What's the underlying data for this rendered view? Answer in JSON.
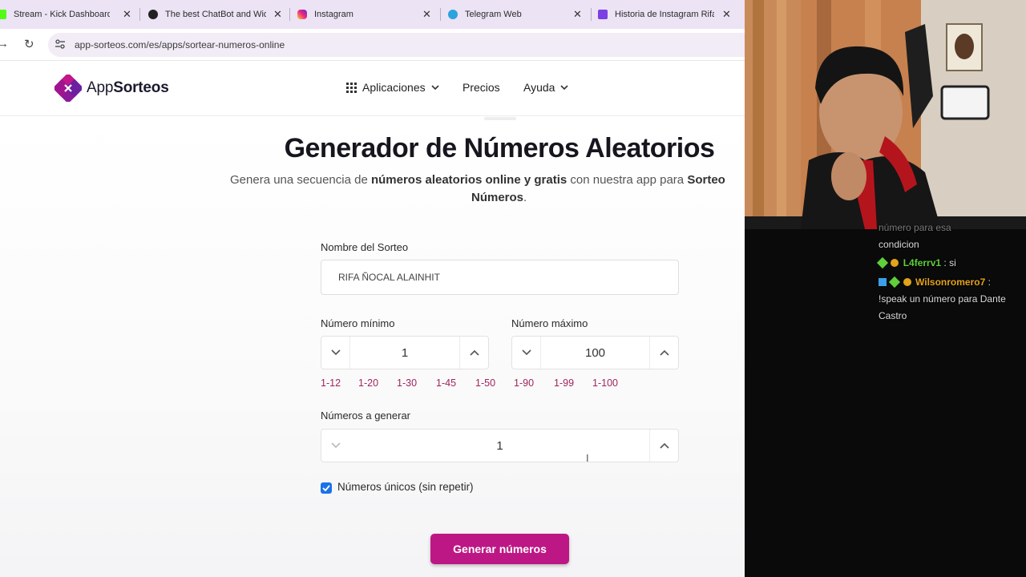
{
  "tabs": [
    {
      "title": "Stream - Kick Dashboard",
      "color": "#53fc18"
    },
    {
      "title": "The best ChatBot and Wid",
      "color": "#222222"
    },
    {
      "title": "Instagram",
      "color": "#d62976"
    },
    {
      "title": "Telegram Web",
      "color": "#2aa3df"
    },
    {
      "title": "Historia de Instagram Rifa",
      "color": "#7b3fe4"
    }
  ],
  "address_bar": {
    "url": "app-sorteos.com/es/apps/sortear-numeros-online"
  },
  "site": {
    "brand_light": "App",
    "brand_bold": "Sorteos",
    "nav": {
      "apps": "Aplicaciones",
      "pricing": "Precios",
      "help": "Ayuda"
    }
  },
  "hero": {
    "title": "Generador de Números Aleatorios",
    "subtitle_part1": "Genera una secuencia de ",
    "subtitle_bold1": "números aleatorios online y gratis",
    "subtitle_part2": " con nuestra app para ",
    "subtitle_bold2": "Sorteo",
    "subtitle_bold3": "Números",
    "subtitle_end": "."
  },
  "form": {
    "name_label": "Nombre del Sorteo",
    "name_value": "RIFA ÑOCAL ALAINHIT",
    "min_label": "Número mínimo",
    "min_value": "1",
    "max_label": "Número máximo",
    "max_value": "100",
    "presets": [
      "1-12",
      "1-20",
      "1-30",
      "1-45",
      "1-50",
      "1-90",
      "1-99",
      "1-100"
    ],
    "count_label": "Números a generar",
    "count_value": "1",
    "unique_label": "Números únicos (sin repetir)",
    "unique_checked": true,
    "generate_label": "Generar números"
  },
  "chat": {
    "partial_line1": "número para esa",
    "partial_line2": "condicion",
    "msg1_user": "L4ferrv1",
    "msg1_text": " : si",
    "msg2_user": "Wilsonromero7",
    "msg2_text": " :",
    "msg2_body": "!speak un número para Dante Castro"
  },
  "colors": {
    "accent": "#bd1785",
    "preset_link": "#a0245f",
    "checkbox": "#1a73e8"
  }
}
